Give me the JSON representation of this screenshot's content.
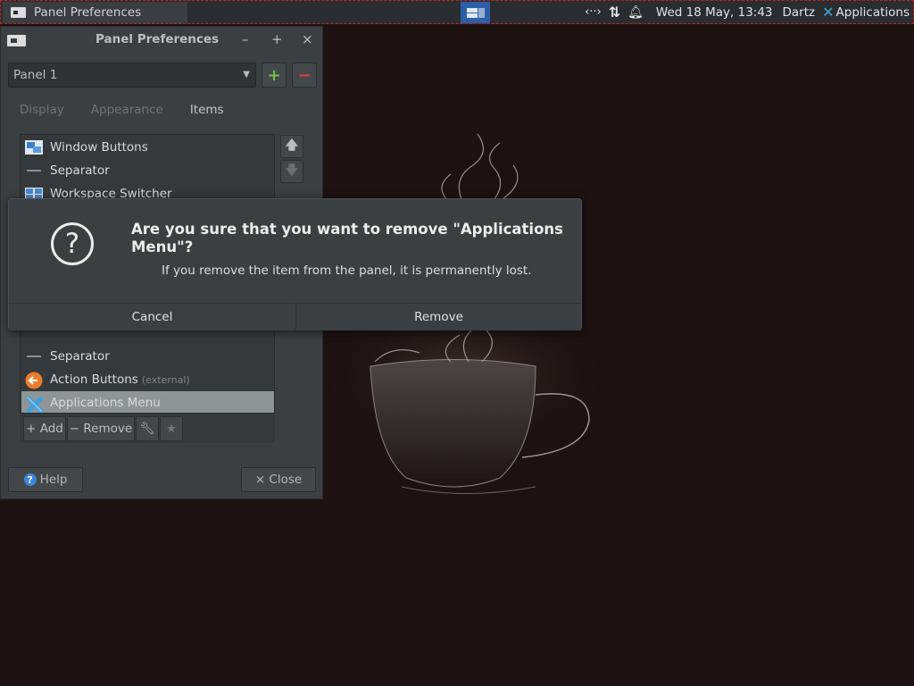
{
  "top_panel": {
    "task_title": "Panel Preferences",
    "clock": "Wed 18 May, 13:43",
    "user": "Dartz",
    "applications_label": "Applications",
    "tray_icons": [
      "network-activity-icon",
      "updown-arrows-icon",
      "bell-icon"
    ]
  },
  "prefs_window": {
    "title": "Panel Preferences",
    "controls": [
      "–",
      "+",
      "×"
    ],
    "panel_select_value": "Panel 1",
    "add_panel_label": "+",
    "remove_panel_label": "−",
    "tabs": [
      "Display",
      "Appearance",
      "Items"
    ],
    "active_tab": "Items",
    "items": [
      {
        "label": "Window Buttons",
        "icon": "window-buttons-icon"
      },
      {
        "label": "Separator",
        "icon": "separator-icon"
      },
      {
        "label": "Workspace Switcher",
        "icon": "workspace-switcher-icon"
      },
      {
        "label": "Separator",
        "icon": "separator-icon"
      },
      {
        "label": "Action Buttons",
        "extra": "(external)",
        "icon": "action-buttons-icon"
      },
      {
        "label": "Applications Menu",
        "icon": "applications-menu-icon",
        "selected": true
      }
    ],
    "list_buttons": {
      "add": "+ Add",
      "remove": "− Remove"
    },
    "help_label": "Help",
    "close_label": "× Close"
  },
  "dialog": {
    "title": "Are you sure that you want to remove \"Applications Menu\"?",
    "body": "If you remove the item from the panel, it is permanently lost.",
    "cancel_label": "Cancel",
    "remove_label": "Remove"
  },
  "colors": {
    "desktop_bg": "#1d1111",
    "panel_bg": "#2a2d2f",
    "window_bg": "#3b3f41",
    "accent_blue": "#2d5ea8",
    "add_green": "#76c043",
    "remove_red": "#e0433c"
  }
}
